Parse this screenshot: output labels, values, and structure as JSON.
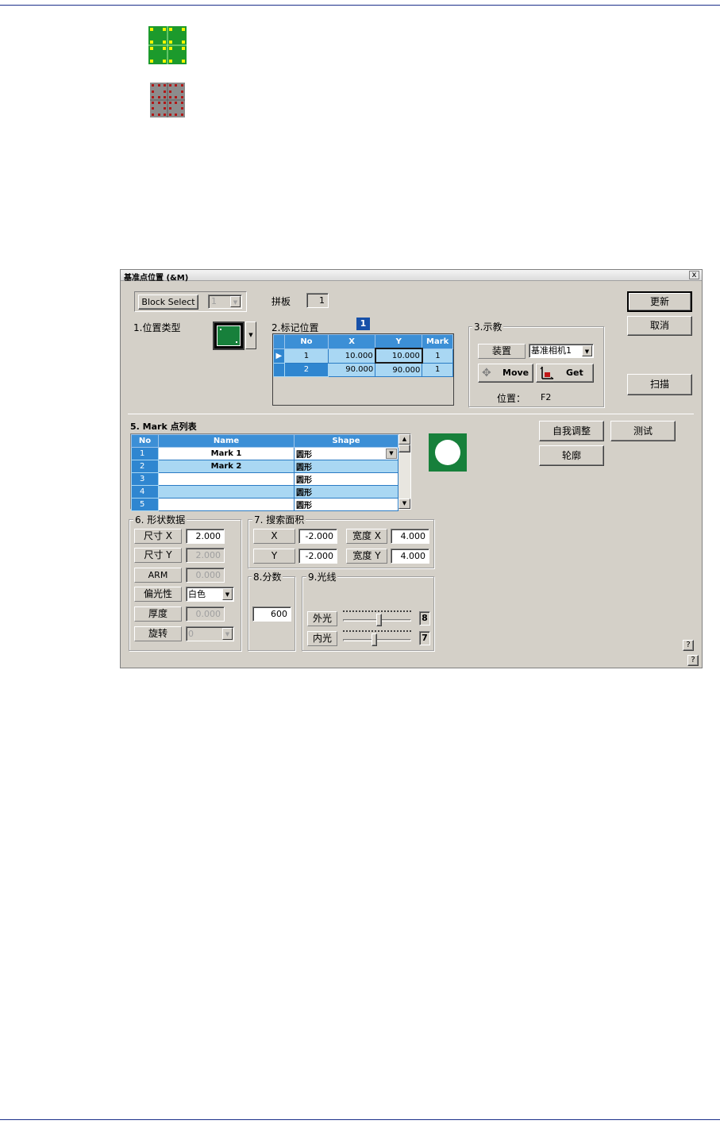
{
  "window": {
    "title": "基准点位置 (&M)",
    "close_label": "x"
  },
  "top": {
    "block_select_label": "Block Select",
    "block_select_value": "1",
    "panel_label": "拼板",
    "panel_value": "1",
    "update_label": "更新",
    "cancel_label": "取消",
    "scan_label": "扫描"
  },
  "section1": {
    "label": "1.位置类型"
  },
  "section2": {
    "label": "2.标记位置",
    "badge": "1",
    "columns": [
      "No",
      "X",
      "Y",
      "Mark"
    ],
    "rows": [
      {
        "no": "1",
        "x": "10.000",
        "y": "10.000",
        "mark": "1"
      },
      {
        "no": "2",
        "x": "90.000",
        "y": "90.000",
        "mark": "1"
      }
    ]
  },
  "section3": {
    "label": "3.示教",
    "device_label": "装置",
    "device_value": "基准相机1",
    "move_label": "Move",
    "get_label": "Get",
    "position_label": "位置：",
    "position_value": "F2"
  },
  "section5": {
    "label": "5. Mark 点列表",
    "columns": [
      "No",
      "Name",
      "Shape"
    ],
    "rows": [
      {
        "no": "1",
        "name": "Mark 1",
        "shape": "圆形"
      },
      {
        "no": "2",
        "name": "Mark 2",
        "shape": "圆形"
      },
      {
        "no": "3",
        "name": "",
        "shape": "圆形"
      },
      {
        "no": "4",
        "name": "",
        "shape": "圆形"
      },
      {
        "no": "5",
        "name": "",
        "shape": "圆形"
      }
    ]
  },
  "actions": {
    "self_adjust_label": "自我调整",
    "test_label": "测试",
    "contour_label": "轮廓"
  },
  "section6": {
    "label": "6. 形状数据",
    "size_x_label": "尺寸 X",
    "size_x_value": "2.000",
    "size_y_label": "尺寸 Y",
    "size_y_value": "2.000",
    "arm_label": "ARM",
    "arm_value": "0.000",
    "polarity_label": "偏光性",
    "polarity_value": "白色",
    "thickness_label": "厚度",
    "thickness_value": "0.000",
    "rotation_label": "旋转",
    "rotation_value": "0"
  },
  "section7": {
    "label": "7. 搜索面积",
    "x_label": "X",
    "x_value": "-2.000",
    "width_x_label": "宽度 X",
    "width_x_value": "4.000",
    "y_label": "Y",
    "y_value": "-2.000",
    "width_y_label": "宽度 Y",
    "width_y_value": "4.000"
  },
  "section8": {
    "label": "8.分数",
    "score_value": "600"
  },
  "section9": {
    "label": "9.光线",
    "outer_label": "外光",
    "outer_value": "8",
    "inner_label": "内光",
    "inner_value": "7"
  },
  "help": {
    "label": "?"
  },
  "colors": {
    "accent": "#3c8fd6",
    "mark_green": "#17803b",
    "window_bg": "#d4d0c8"
  }
}
